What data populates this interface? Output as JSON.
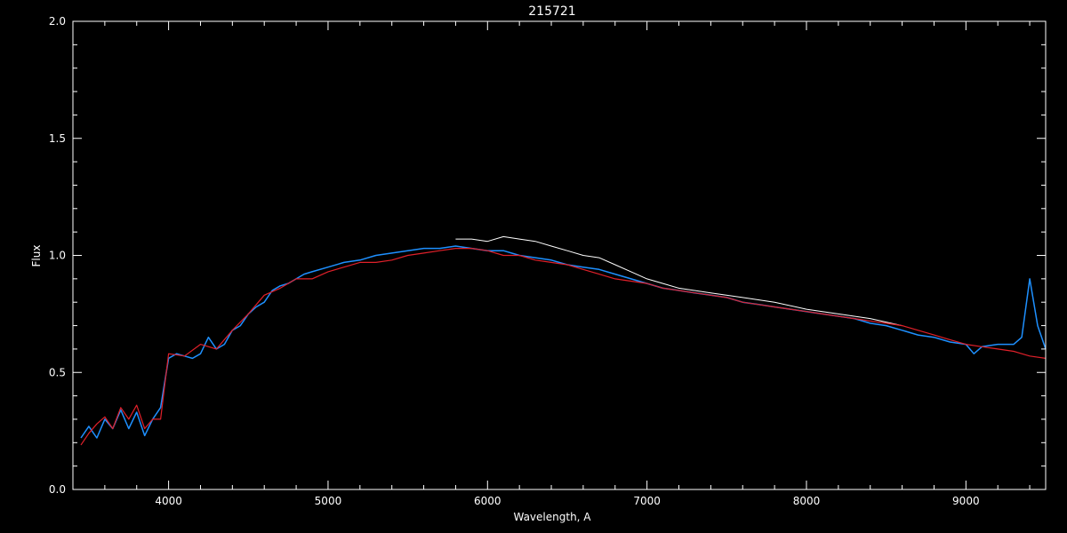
{
  "chart_data": {
    "type": "line",
    "title": "215721",
    "xlabel": "Wavelength, A",
    "ylabel": "Flux",
    "xlim": [
      3400,
      9500
    ],
    "ylim": [
      0,
      2.0
    ],
    "xticks": [
      4000,
      5000,
      6000,
      7000,
      8000,
      9000
    ],
    "xtick_labels": [
      "4000",
      "5000",
      "6000",
      "7000",
      "8000",
      "9000"
    ],
    "yticks": [
      0.0,
      0.5,
      1.0,
      1.5,
      2.0
    ],
    "ytick_labels": [
      "0.0",
      "0.5",
      "1.0",
      "1.5",
      "2.0"
    ],
    "grid": false,
    "legend": "none",
    "colors": {
      "background": "#000000",
      "axes": "#ffffff",
      "observed": "#1e90ff",
      "reference": "#ffffff",
      "model": "#e0202a"
    },
    "series": [
      {
        "color": "#ffffff",
        "x": [
          5800,
          5900,
          6000,
          6100,
          6200,
          6300,
          6400,
          6500,
          6600,
          6700,
          6800,
          6900,
          7000,
          7100,
          7200,
          7400,
          7600,
          7800,
          8000,
          8200,
          8400,
          8600
        ],
        "y": [
          1.07,
          1.07,
          1.06,
          1.08,
          1.07,
          1.06,
          1.04,
          1.02,
          1.0,
          0.99,
          0.96,
          0.93,
          0.9,
          0.88,
          0.86,
          0.84,
          0.82,
          0.8,
          0.77,
          0.75,
          0.73,
          0.7
        ]
      },
      {
        "color": "#1e90ff",
        "x": [
          3450,
          3500,
          3550,
          3600,
          3650,
          3700,
          3750,
          3800,
          3850,
          3900,
          3950,
          4000,
          4050,
          4100,
          4150,
          4200,
          4250,
          4300,
          4350,
          4400,
          4450,
          4500,
          4550,
          4600,
          4650,
          4700,
          4750,
          4800,
          4850,
          4900,
          5000,
          5100,
          5200,
          5300,
          5400,
          5500,
          5600,
          5700,
          5800,
          5900,
          6000,
          6100,
          6200,
          6300,
          6400,
          6500,
          6600,
          6700,
          6800,
          6900,
          7000,
          7100,
          7200,
          7300,
          7400,
          7500,
          7600,
          7700,
          7800,
          7900,
          8000,
          8100,
          8200,
          8300,
          8400,
          8500,
          8600,
          8700,
          8800,
          8900,
          9000,
          9050,
          9100,
          9200,
          9300,
          9350,
          9400,
          9450,
          9500
        ],
        "y": [
          0.22,
          0.27,
          0.22,
          0.3,
          0.26,
          0.34,
          0.26,
          0.33,
          0.23,
          0.3,
          0.35,
          0.56,
          0.58,
          0.57,
          0.56,
          0.58,
          0.65,
          0.6,
          0.62,
          0.68,
          0.7,
          0.75,
          0.78,
          0.8,
          0.85,
          0.87,
          0.88,
          0.9,
          0.92,
          0.93,
          0.95,
          0.97,
          0.98,
          1.0,
          1.01,
          1.02,
          1.03,
          1.03,
          1.04,
          1.03,
          1.02,
          1.02,
          1.0,
          0.99,
          0.98,
          0.96,
          0.95,
          0.94,
          0.92,
          0.9,
          0.88,
          0.86,
          0.85,
          0.84,
          0.83,
          0.82,
          0.8,
          0.79,
          0.78,
          0.77,
          0.76,
          0.75,
          0.74,
          0.73,
          0.71,
          0.7,
          0.68,
          0.66,
          0.65,
          0.63,
          0.62,
          0.58,
          0.61,
          0.62,
          0.62,
          0.65,
          0.9,
          0.7,
          0.6
        ]
      },
      {
        "color": "#e0202a",
        "x": [
          3450,
          3500,
          3550,
          3600,
          3650,
          3700,
          3750,
          3800,
          3850,
          3900,
          3950,
          4000,
          4100,
          4200,
          4300,
          4400,
          4500,
          4600,
          4700,
          4800,
          4900,
          5000,
          5100,
          5200,
          5300,
          5400,
          5500,
          5600,
          5700,
          5800,
          5900,
          6000,
          6100,
          6200,
          6300,
          6400,
          6500,
          6600,
          6700,
          6800,
          6900,
          7000,
          7100,
          7200,
          7300,
          7400,
          7500,
          7600,
          7700,
          7800,
          7900,
          8000,
          8100,
          8200,
          8300,
          8400,
          8500,
          8600,
          8700,
          8800,
          8900,
          9000,
          9100,
          9200,
          9300,
          9400,
          9500
        ],
        "y": [
          0.19,
          0.24,
          0.28,
          0.31,
          0.26,
          0.35,
          0.3,
          0.36,
          0.26,
          0.3,
          0.3,
          0.58,
          0.57,
          0.62,
          0.6,
          0.68,
          0.75,
          0.83,
          0.86,
          0.9,
          0.9,
          0.93,
          0.95,
          0.97,
          0.97,
          0.98,
          1.0,
          1.01,
          1.02,
          1.03,
          1.03,
          1.02,
          1.0,
          1.0,
          0.98,
          0.97,
          0.96,
          0.94,
          0.92,
          0.9,
          0.89,
          0.88,
          0.86,
          0.85,
          0.84,
          0.83,
          0.82,
          0.8,
          0.79,
          0.78,
          0.77,
          0.76,
          0.75,
          0.74,
          0.73,
          0.72,
          0.71,
          0.7,
          0.68,
          0.66,
          0.64,
          0.62,
          0.61,
          0.6,
          0.59,
          0.57,
          0.56
        ]
      }
    ]
  }
}
